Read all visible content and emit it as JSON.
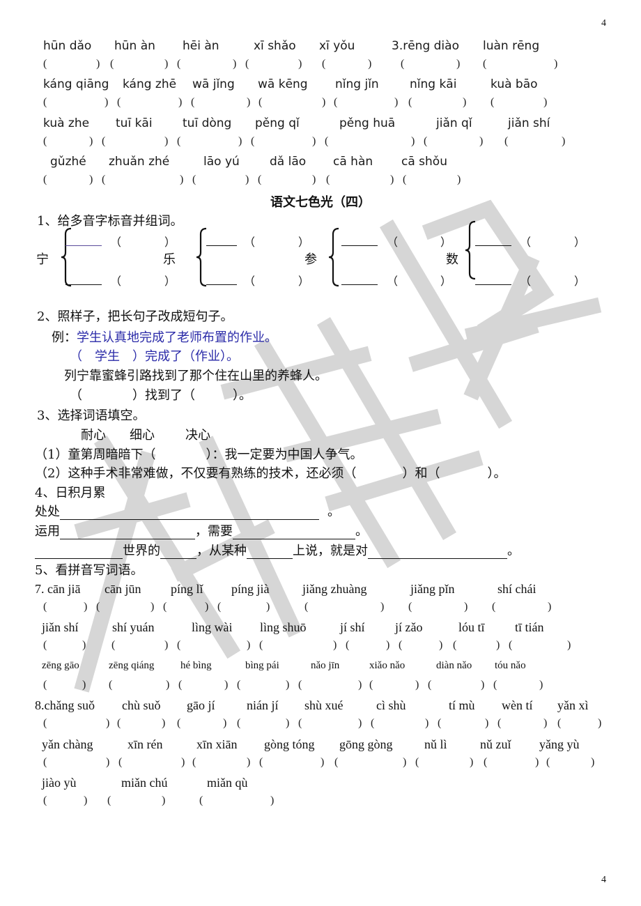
{
  "page_number_top": "4",
  "page_number_bottom": "4",
  "watermark_text": "权威辅导",
  "section_top_pinyin": {
    "rows": [
      {
        "words": [
          "hūn dǎo",
          "hūn àn",
          "hēi àn",
          "xī shǎo",
          "xī yǒu",
          "3.rēng diào",
          "luàn rēng"
        ]
      },
      {
        "words": [
          "káng qiāng",
          "káng zhē",
          "wā jǐng",
          "wā kēng",
          "nǐng jǐn",
          "nǐng kāi",
          "kuà bāo"
        ]
      },
      {
        "words": [
          "kuà zhe",
          "tuī kāi",
          "tuī dòng",
          "pěng qǐ",
          "pěng huā",
          "jiǎn qǐ",
          "jiǎn shí"
        ]
      },
      {
        "words": [
          "gǔzhé",
          "zhuǎn zhé",
          "lāo yú",
          "dǎ lāo",
          "cā hàn",
          "cā shǒu"
        ]
      }
    ]
  },
  "title": "语文七色光（四）",
  "q1": {
    "heading": "1、给多音字标音并组词。",
    "chars": [
      "宁",
      "乐",
      "参",
      "数"
    ],
    "open_paren": "（",
    "close_paren": "）"
  },
  "q2": {
    "heading": "2、照样子，把长句子改成短句子。",
    "example_label": "例：",
    "example_sentence": "学生认真地完成了老师布置的作业。",
    "example_answer": "（　学生　）完成了（作业）。",
    "sentence": "列宁靠蜜蜂引路找到了那个住在山里的养蜂人。",
    "answer_template": "（　　　　）找到了（　　　）。"
  },
  "q3": {
    "heading": "3、选择词语填空。",
    "options": [
      "耐心",
      "细心",
      "决心"
    ],
    "item1": "（1）童第周暗暗下（　　　　）：我一定要为中国人争气。",
    "item2_a": "（2）这种手术非常难做，不仅要有熟练的技术，还必须（",
    "item2_b": "）和（",
    "item2_c": "）。"
  },
  "q4": {
    "heading": "4、日积月累",
    "line1_prefix": "处处",
    "line1_suffix": "。",
    "line2_prefix": "运用",
    "line2_mid": "，需要",
    "line2_suffix": "。",
    "line3_a": "世界的",
    "line3_b": "，从某种",
    "line3_c": "上说，就是对",
    "line3_suffix": "。"
  },
  "q5": {
    "heading": "5、看拼音写词语。",
    "rows": [
      {
        "words": [
          "7. cān jiā",
          "cān jūn",
          "píng lǐ",
          "píng jià",
          "jiǎng zhuàng",
          "jiǎng pǐn",
          "shí chái"
        ]
      },
      {
        "words": [
          "jiǎn shí",
          "shí yuán",
          "lìng wài",
          "lìng shuō",
          "jí shí",
          "jí zǎo",
          "lóu tī",
          "tī tián"
        ]
      },
      {
        "words": [
          "zēng gāo",
          "zēng qiáng",
          "hé bìng",
          "bìng pái",
          "nǎo jīn",
          "xiǎo nǎo",
          "diàn nǎo",
          "tóu nǎo"
        ]
      },
      {
        "words": [
          "8.chǎng suǒ",
          "chù suǒ",
          "gāo jí",
          "nián jí",
          "shù xué",
          "cì shù",
          "tí mù",
          "wèn tí",
          "yǎn xì"
        ]
      },
      {
        "words": [
          "yǎn chàng",
          "xīn rén",
          "xīn xiān",
          "gòng tóng",
          "gōng gòng",
          "nǔ lì",
          "nǔ zuǐ",
          "yǎng yù"
        ]
      },
      {
        "words": [
          "jiào yù",
          "miǎn chú",
          "miǎn qù"
        ]
      }
    ]
  },
  "colors": {
    "text": "#111111",
    "example_blue": "#2a2aa8",
    "watermark_gray": "#c8c8c8"
  }
}
